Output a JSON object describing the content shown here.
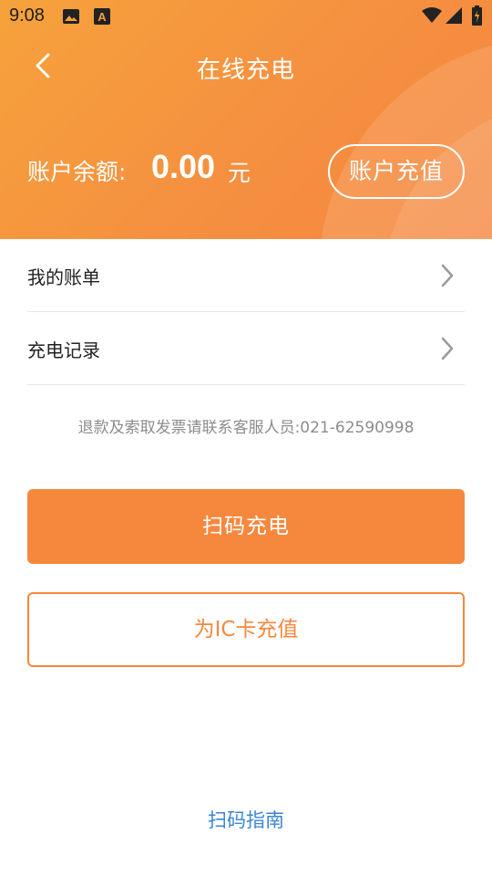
{
  "status_bar": {
    "time": "9:08",
    "icons": [
      "image-icon",
      "notification-a-icon",
      "wifi-icon",
      "signal-icon",
      "battery-icon"
    ]
  },
  "nav": {
    "back_icon": "chevron-left-icon",
    "title": "在线充电"
  },
  "account": {
    "balance_label": "账户余额:",
    "balance_amount": "0.00",
    "balance_unit": "元",
    "recharge_label": "账户充值"
  },
  "menu": {
    "items": [
      {
        "label": "我的账单",
        "icon": "chevron-right-icon"
      },
      {
        "label": "充电记录",
        "icon": "chevron-right-icon"
      }
    ]
  },
  "notice": "退款及索取发票请联系客服人员:021-62590998",
  "actions": {
    "scan_charge_label": "扫码充电",
    "ic_card_label": "为IC卡充值",
    "scan_guide_label": "扫码指南"
  },
  "colors": {
    "accent": "#f5883d",
    "header_gradient_start": "#f6a23c",
    "header_gradient_end": "#f5863e",
    "link": "#3b86d4",
    "notice_text": "#8c8c8c"
  }
}
